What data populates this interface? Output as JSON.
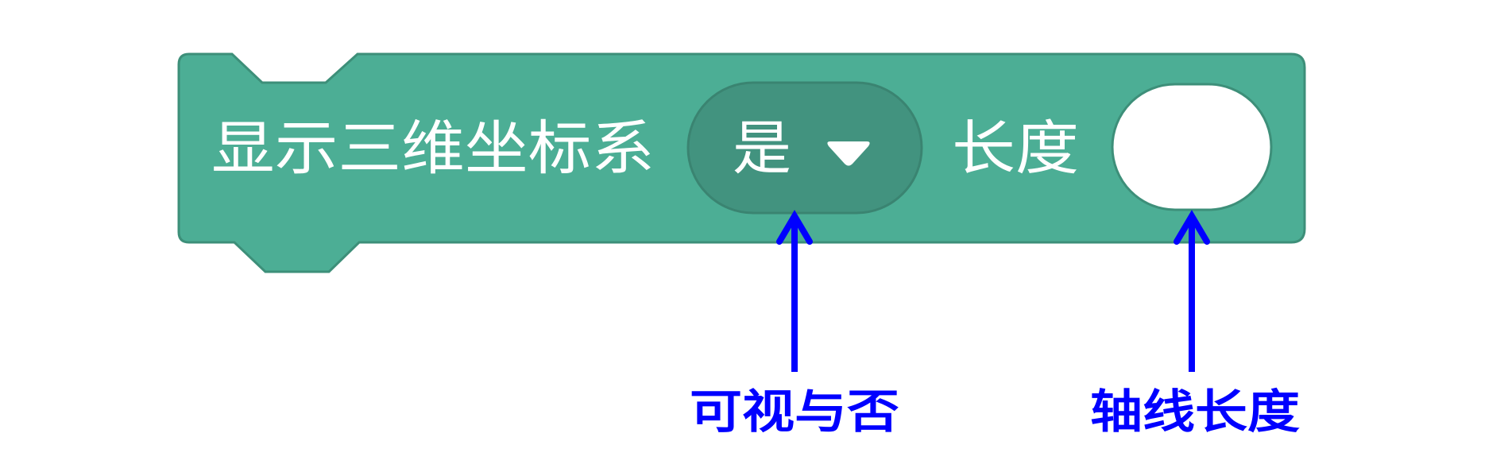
{
  "block": {
    "label": "显示三维坐标系",
    "dropdown": {
      "value": "是"
    },
    "length_label": "长度",
    "length_input_value": ""
  },
  "annotations": {
    "visibility": "可视与否",
    "axis_length": "轴线长度"
  },
  "colors": {
    "block_fill": "#4cae95",
    "block_stroke": "#3d8f79",
    "dropdown_fill": "#3f8a78",
    "annotation": "#0000ff"
  },
  "icons": {
    "dropdown_caret": "triangle-down-icon",
    "arrow": "arrow-up-icon"
  }
}
